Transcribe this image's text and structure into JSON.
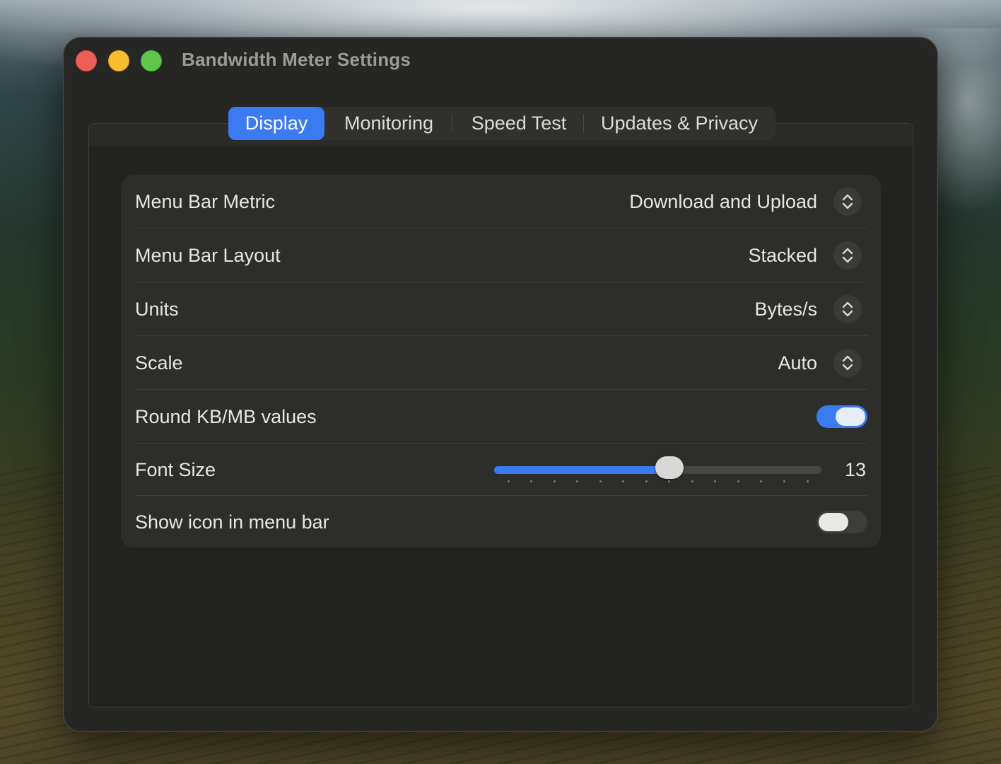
{
  "window": {
    "title": "Bandwidth Meter Settings",
    "traffic_lights": [
      "close",
      "minimize",
      "zoom"
    ]
  },
  "tabs": [
    {
      "label": "Display",
      "active": true
    },
    {
      "label": "Monitoring",
      "active": false
    },
    {
      "label": "Speed Test",
      "active": false
    },
    {
      "label": "Updates & Privacy",
      "active": false
    }
  ],
  "settings": {
    "menu_bar_metric": {
      "label": "Menu Bar Metric",
      "value": "Download and Upload"
    },
    "menu_bar_layout": {
      "label": "Menu Bar Layout",
      "value": "Stacked"
    },
    "units": {
      "label": "Units",
      "value": "Bytes/s"
    },
    "scale": {
      "label": "Scale",
      "value": "Auto"
    },
    "round_values": {
      "label": "Round KB/MB values",
      "enabled": true
    },
    "font_size": {
      "label": "Font Size",
      "value": "13",
      "min": 6,
      "max": 19,
      "current": 13
    },
    "show_icon": {
      "label": "Show icon in menu bar",
      "enabled": false
    }
  },
  "colors": {
    "accent": "#3a7bf2",
    "window_bg": "#262624",
    "close": "#ee5e56",
    "minimize": "#f6be2f",
    "zoom": "#5fc84a"
  },
  "icons": {
    "stepper": "chevron-up-down-icon"
  }
}
